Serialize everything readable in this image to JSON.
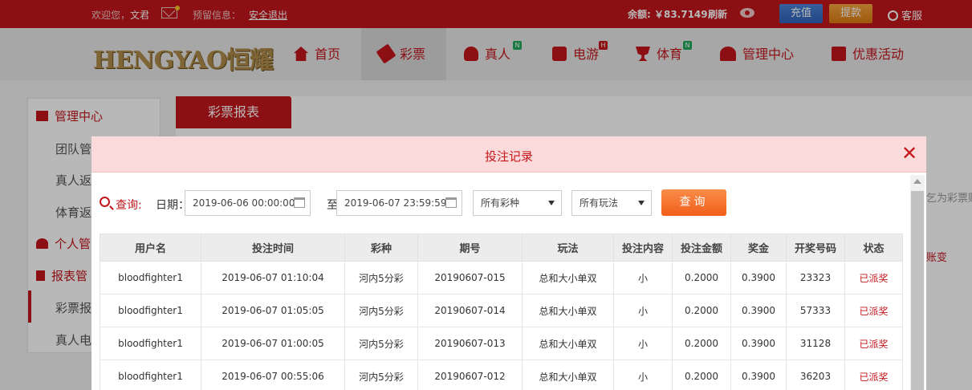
{
  "topbar": {
    "welcome_prefix": "欢迎您，",
    "username": "文君",
    "reserve_label": "预留信息：",
    "logout_label": "安全退出",
    "balance": "余额: ￥83.7149",
    "refresh_label": "刷新",
    "deposit_label": "充值",
    "withdraw_label": "提款",
    "service_label": "客服"
  },
  "logo": {
    "text": "HENGYAO恒耀"
  },
  "nav": {
    "items": [
      {
        "label": "首页"
      },
      {
        "label": "彩票"
      },
      {
        "label": "真人",
        "badge": "N"
      },
      {
        "label": "电游",
        "badge": "H"
      },
      {
        "label": "体育",
        "badge": "N"
      },
      {
        "label": "管理中心"
      },
      {
        "label": "优惠活动"
      }
    ]
  },
  "sidebar": {
    "heads": [
      "管理中心",
      "个人管",
      "报表管"
    ],
    "items": [
      "团队管",
      "真人返",
      "体育返",
      "彩票报",
      "真人电"
    ]
  },
  "content": {
    "tab_label": "彩票报表",
    "right_note": "乞为彩票账",
    "right_link": "账变"
  },
  "modal": {
    "title": "投注记录",
    "close_symbol": "✕",
    "query_label": "查询:",
    "date_label": "日期：",
    "start_date": "2019-06-06 00:00:00",
    "to_label": "至",
    "end_date": "2019-06-07 23:59:59",
    "lottery_select": "所有彩种",
    "play_select": "所有玩法",
    "search_button": "查询"
  },
  "table": {
    "headers": [
      "用户名",
      "投注时间",
      "彩种",
      "期号",
      "玩法",
      "投注内容",
      "投注金额",
      "奖金",
      "开奖号码",
      "状态"
    ],
    "rows": [
      [
        "bloodfighter1",
        "2019-06-07 01:10:04",
        "河内5分彩",
        "20190607-015",
        "总和大小单双",
        "小",
        "0.2000",
        "0.3900",
        "23323",
        "已派奖"
      ],
      [
        "bloodfighter1",
        "2019-06-07 01:05:05",
        "河内5分彩",
        "20190607-014",
        "总和大小单双",
        "小",
        "0.2000",
        "0.3900",
        "57333",
        "已派奖"
      ],
      [
        "bloodfighter1",
        "2019-06-07 01:00:05",
        "河内5分彩",
        "20190607-013",
        "总和大小单双",
        "小",
        "0.2000",
        "0.3900",
        "31128",
        "已派奖"
      ],
      [
        "bloodfighter1",
        "2019-06-07 00:55:06",
        "河内5分彩",
        "20190607-012",
        "总和大小单双",
        "小",
        "0.2000",
        "0.3900",
        "36203",
        "已派奖"
      ]
    ]
  },
  "colors": {
    "brand_red": "#c3161c",
    "deposit_blue": "#3a70c4",
    "withdraw_orange": "#e8901f",
    "search_orange": "#f46a26",
    "badge_green": "#24a859"
  }
}
